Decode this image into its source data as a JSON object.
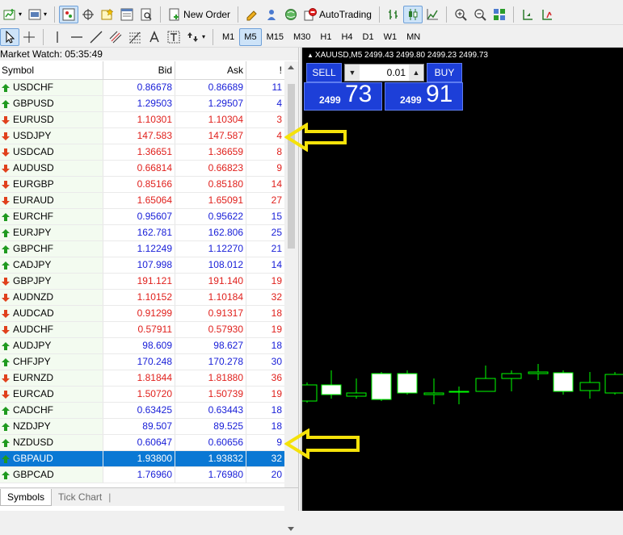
{
  "toolbar": {
    "new_order_label": "New Order",
    "autotrading_label": "AutoTrading",
    "timeframes": [
      "M1",
      "M5",
      "M15",
      "M30",
      "H1",
      "H4",
      "D1",
      "W1",
      "MN"
    ],
    "active_timeframe": "M5"
  },
  "market_watch": {
    "title": "Market Watch: 05:35:49",
    "columns": {
      "symbol": "Symbol",
      "bid": "Bid",
      "ask": "Ask",
      "spread": "!"
    },
    "rows": [
      {
        "symbol": "USDCHF",
        "bid": "0.86678",
        "ask": "0.86689",
        "spread": "11",
        "dir": "up"
      },
      {
        "symbol": "GBPUSD",
        "bid": "1.29503",
        "ask": "1.29507",
        "spread": "4",
        "dir": "up"
      },
      {
        "symbol": "EURUSD",
        "bid": "1.10301",
        "ask": "1.10304",
        "spread": "3",
        "dir": "down"
      },
      {
        "symbol": "USDJPY",
        "bid": "147.583",
        "ask": "147.587",
        "spread": "4",
        "dir": "down"
      },
      {
        "symbol": "USDCAD",
        "bid": "1.36651",
        "ask": "1.36659",
        "spread": "8",
        "dir": "down"
      },
      {
        "symbol": "AUDUSD",
        "bid": "0.66814",
        "ask": "0.66823",
        "spread": "9",
        "dir": "down"
      },
      {
        "symbol": "EURGBP",
        "bid": "0.85166",
        "ask": "0.85180",
        "spread": "14",
        "dir": "down"
      },
      {
        "symbol": "EURAUD",
        "bid": "1.65064",
        "ask": "1.65091",
        "spread": "27",
        "dir": "down"
      },
      {
        "symbol": "EURCHF",
        "bid": "0.95607",
        "ask": "0.95622",
        "spread": "15",
        "dir": "up"
      },
      {
        "symbol": "EURJPY",
        "bid": "162.781",
        "ask": "162.806",
        "spread": "25",
        "dir": "up"
      },
      {
        "symbol": "GBPCHF",
        "bid": "1.12249",
        "ask": "1.12270",
        "spread": "21",
        "dir": "up"
      },
      {
        "symbol": "CADJPY",
        "bid": "107.998",
        "ask": "108.012",
        "spread": "14",
        "dir": "up"
      },
      {
        "symbol": "GBPJPY",
        "bid": "191.121",
        "ask": "191.140",
        "spread": "19",
        "dir": "down"
      },
      {
        "symbol": "AUDNZD",
        "bid": "1.10152",
        "ask": "1.10184",
        "spread": "32",
        "dir": "down"
      },
      {
        "symbol": "AUDCAD",
        "bid": "0.91299",
        "ask": "0.91317",
        "spread": "18",
        "dir": "down"
      },
      {
        "symbol": "AUDCHF",
        "bid": "0.57911",
        "ask": "0.57930",
        "spread": "19",
        "dir": "down"
      },
      {
        "symbol": "AUDJPY",
        "bid": "98.609",
        "ask": "98.627",
        "spread": "18",
        "dir": "up"
      },
      {
        "symbol": "CHFJPY",
        "bid": "170.248",
        "ask": "170.278",
        "spread": "30",
        "dir": "up"
      },
      {
        "symbol": "EURNZD",
        "bid": "1.81844",
        "ask": "1.81880",
        "spread": "36",
        "dir": "down"
      },
      {
        "symbol": "EURCAD",
        "bid": "1.50720",
        "ask": "1.50739",
        "spread": "19",
        "dir": "down"
      },
      {
        "symbol": "CADCHF",
        "bid": "0.63425",
        "ask": "0.63443",
        "spread": "18",
        "dir": "up"
      },
      {
        "symbol": "NZDJPY",
        "bid": "89.507",
        "ask": "89.525",
        "spread": "18",
        "dir": "up"
      },
      {
        "symbol": "NZDUSD",
        "bid": "0.60647",
        "ask": "0.60656",
        "spread": "9",
        "dir": "up"
      },
      {
        "symbol": "GBPAUD",
        "bid": "1.93800",
        "ask": "1.93832",
        "spread": "32",
        "dir": "up",
        "selected": true
      },
      {
        "symbol": "GBPCAD",
        "bid": "1.76960",
        "ask": "1.76980",
        "spread": "20",
        "dir": "up"
      }
    ],
    "tabs": [
      "Symbols",
      "Tick Chart"
    ]
  },
  "chart": {
    "title": "XAUUSD,M5  2499.43 2499.80 2499.23 2499.73",
    "sell_label": "SELL",
    "buy_label": "BUY",
    "lot_value": "0.01",
    "sell_price_big": "2499",
    "sell_price_pips": "73",
    "buy_price_big": "2499",
    "buy_price_pips": "91",
    "colors": {
      "background": "#000000",
      "candle": "#00ff00",
      "bull_body": "#ffffff",
      "panel": "#1d3fd8"
    }
  },
  "annotations": {
    "arrow_color": "#f5e20a",
    "arrow_rows": [
      "USDJPY",
      "NZDUSD"
    ]
  }
}
